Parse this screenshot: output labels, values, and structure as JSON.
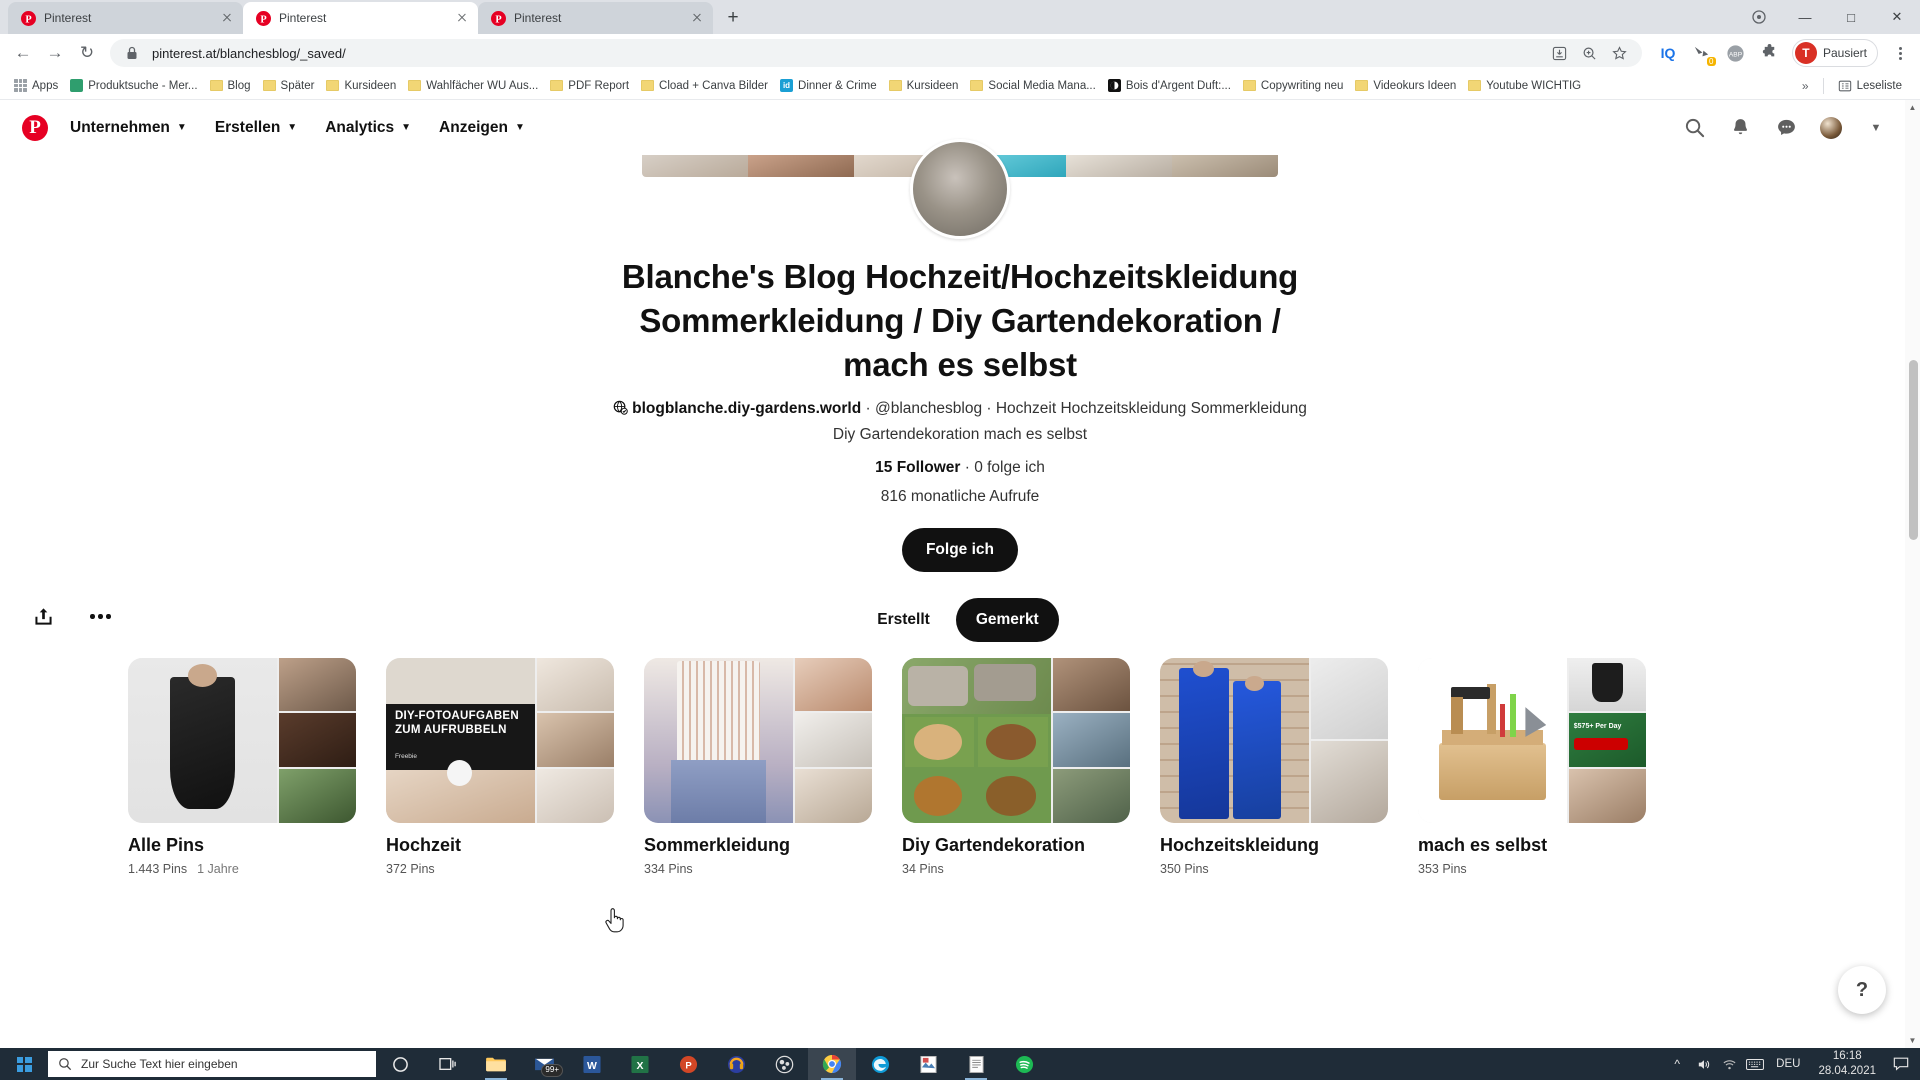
{
  "browser": {
    "tabs": [
      {
        "title": "Pinterest",
        "active": false
      },
      {
        "title": "Pinterest",
        "active": true
      },
      {
        "title": "Pinterest",
        "active": false
      }
    ],
    "new_tab_label": "+",
    "window_controls": {
      "minimize": "—",
      "maximize": "□",
      "close": "✕"
    },
    "nav": {
      "back": "←",
      "forward": "→",
      "reload": "↻"
    },
    "omnibox": {
      "url": "pinterest.at/blanchesblog/_saved/",
      "lock_icon": "lock-icon",
      "install_icon": "install-icon",
      "zoom_icon": "zoom-icon",
      "star_icon": "star-icon"
    },
    "extensions": [
      {
        "name": "iq-extension",
        "label": "IQ"
      },
      {
        "name": "pocket-extension",
        "label": "0"
      },
      {
        "name": "adblock-plus-extension",
        "label": "ABP"
      },
      {
        "name": "extensions-puzzle",
        "label": ""
      }
    ],
    "profile": {
      "initial": "T",
      "label": "Pausiert"
    },
    "bookmarks": [
      {
        "label": "Apps",
        "icon": "apps-grid-icon"
      },
      {
        "label": "Produktsuche - Mer...",
        "icon": "site-icon"
      },
      {
        "label": "Blog",
        "icon": "folder-icon"
      },
      {
        "label": "Später",
        "icon": "folder-icon"
      },
      {
        "label": "Kursideen",
        "icon": "folder-icon"
      },
      {
        "label": "Wahlfächer WU Aus...",
        "icon": "folder-icon"
      },
      {
        "label": "PDF Report",
        "icon": "folder-icon"
      },
      {
        "label": "Cload + Canva Bilder",
        "icon": "folder-icon"
      },
      {
        "label": "Dinner & Crime",
        "icon": "id-site-icon"
      },
      {
        "label": "Kursideen",
        "icon": "folder-icon"
      },
      {
        "label": "Social Media Mana...",
        "icon": "folder-icon"
      },
      {
        "label": "Bois d'Argent Duft:...",
        "icon": "dark-site-icon"
      },
      {
        "label": "Copywriting neu",
        "icon": "folder-icon"
      },
      {
        "label": "Videokurs Ideen",
        "icon": "folder-icon"
      },
      {
        "label": "Youtube WICHTIG",
        "icon": "folder-icon"
      }
    ],
    "overflow_label": "»",
    "reading_list_label": "Leseliste"
  },
  "pinterest": {
    "nav_items": [
      {
        "label": "Unternehmen",
        "has_chevron": true
      },
      {
        "label": "Erstellen",
        "has_chevron": true
      },
      {
        "label": "Analytics",
        "has_chevron": true
      },
      {
        "label": "Anzeigen",
        "has_chevron": true
      }
    ],
    "right_icons": [
      {
        "name": "search-icon"
      },
      {
        "name": "bell-icon"
      },
      {
        "name": "message-bubble-icon"
      },
      {
        "name": "account-avatar"
      },
      {
        "name": "chevron-down-icon"
      }
    ]
  },
  "profile": {
    "name": "Blanche's Blog Hochzeit/Hochzeitskleidung Sommerkleidung / Diy Gartendekoration / mach es selbst",
    "website": "blogblanche.diy-gardens.world",
    "meta_rest": " · @blanchesblog · Hochzeit Hochzeitskleidung Sommerkleidung Diy Gartendekoration mach es selbst",
    "followers_count": "15 Follower",
    "following_text": " · 0 folge ich",
    "monthly_views": "816 monatliche Aufrufe",
    "follow_button": "Folge ich"
  },
  "tabs": {
    "created": "Erstellt",
    "saved": "Gemerkt",
    "share_icon": "share-icon",
    "more_icon": "more-options-icon"
  },
  "boards": [
    {
      "title": "Alle Pins",
      "pins": "1.443 Pins",
      "extra": "1 Jahre"
    },
    {
      "title": "Hochzeit",
      "pins": "372 Pins",
      "extra": ""
    },
    {
      "title": "Sommerkleidung",
      "pins": "334 Pins",
      "extra": ""
    },
    {
      "title": "Diy Gartendekoration",
      "pins": "34 Pins",
      "extra": ""
    },
    {
      "title": "Hochzeitskleidung",
      "pins": "350 Pins",
      "extra": ""
    },
    {
      "title": "mach es selbst",
      "pins": "353 Pins",
      "extra": ""
    }
  ],
  "help_button": "?",
  "taskbar": {
    "search_placeholder": "Zur Suche Text hier eingeben",
    "apps": [
      {
        "name": "cortana-icon"
      },
      {
        "name": "task-view-icon"
      },
      {
        "name": "file-explorer-icon"
      },
      {
        "name": "mail-icon",
        "badge": "99+"
      },
      {
        "name": "word-icon"
      },
      {
        "name": "excel-icon"
      },
      {
        "name": "powerpoint-icon"
      },
      {
        "name": "audacity-icon"
      },
      {
        "name": "obs-icon"
      },
      {
        "name": "chrome-icon"
      },
      {
        "name": "edge-icon"
      },
      {
        "name": "image-app-icon"
      },
      {
        "name": "notepad-icon"
      },
      {
        "name": "spotify-icon"
      }
    ],
    "language": "DEU",
    "time": "16:18",
    "date": "28.04.2021"
  },
  "colors": {
    "pinterest_red": "#e60023",
    "dark": "#111111",
    "chrome_tabstrip": "#dee1e6",
    "taskbar": "#1f2c38"
  }
}
